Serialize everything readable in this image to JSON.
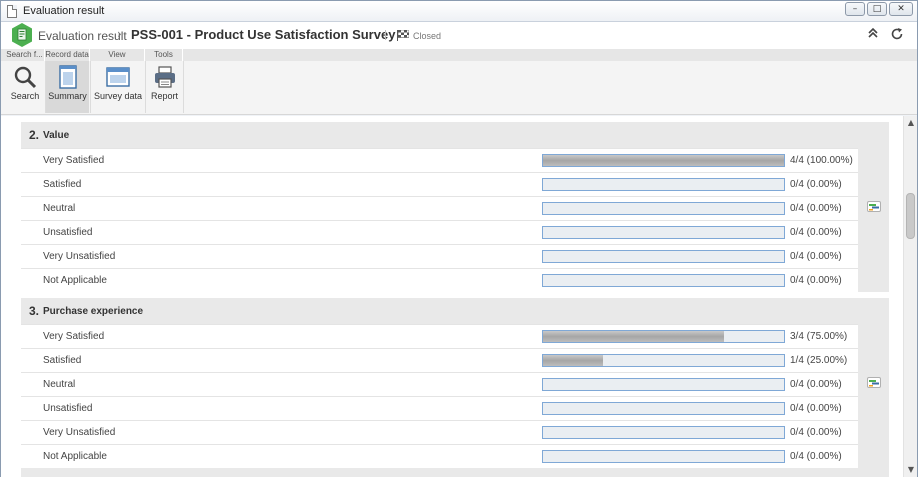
{
  "window": {
    "title": "Evaluation result"
  },
  "header": {
    "breadcrumb_root": "Evaluation result",
    "breadcrumb_sep": "›",
    "page_title": "PSS-001 - Product Use Satisfaction Survey",
    "status": "Closed",
    "collapse_glyph": "⌃",
    "refresh_glyph": "⟳"
  },
  "ribbon": {
    "groups": [
      {
        "label": "Search f..."
      },
      {
        "label": "Record data"
      },
      {
        "label": "View"
      },
      {
        "label": "Tools"
      }
    ],
    "buttons": [
      {
        "label": "Search",
        "icon": "search-icon",
        "active": false
      },
      {
        "label": "Summary",
        "icon": "summary-icon",
        "active": true
      },
      {
        "label": "Survey data",
        "icon": "survey-data-icon",
        "active": false
      },
      {
        "label": "Report",
        "icon": "printer-icon",
        "active": false
      }
    ]
  },
  "sections": [
    {
      "number": "2.",
      "title": "Value",
      "rows": [
        {
          "label": "Very Satisfied",
          "fraction": 1.0,
          "value": "4/4 (100.00%)"
        },
        {
          "label": "Satisfied",
          "fraction": 0.0,
          "value": "0/4 (0.00%)"
        },
        {
          "label": "Neutral",
          "fraction": 0.0,
          "value": "0/4 (0.00%)"
        },
        {
          "label": "Unsatisfied",
          "fraction": 0.0,
          "value": "0/4 (0.00%)"
        },
        {
          "label": "Very Unsatisfied",
          "fraction": 0.0,
          "value": "0/4 (0.00%)"
        },
        {
          "label": "Not Applicable",
          "fraction": 0.0,
          "value": "0/4 (0.00%)"
        }
      ]
    },
    {
      "number": "3.",
      "title": "Purchase experience",
      "rows": [
        {
          "label": "Very Satisfied",
          "fraction": 0.75,
          "value": "3/4 (75.00%)"
        },
        {
          "label": "Satisfied",
          "fraction": 0.25,
          "value": "1/4 (25.00%)"
        },
        {
          "label": "Neutral",
          "fraction": 0.0,
          "value": "0/4 (0.00%)"
        },
        {
          "label": "Unsatisfied",
          "fraction": 0.0,
          "value": "0/4 (0.00%)"
        },
        {
          "label": "Very Unsatisfied",
          "fraction": 0.0,
          "value": "0/4 (0.00%)"
        },
        {
          "label": "Not Applicable",
          "fraction": 0.0,
          "value": "0/4 (0.00%)"
        }
      ]
    }
  ],
  "colors": {
    "bar_border": "#7fa8d6",
    "bar_fill": "#b0b0b0",
    "accent_green": "#4caf50"
  }
}
